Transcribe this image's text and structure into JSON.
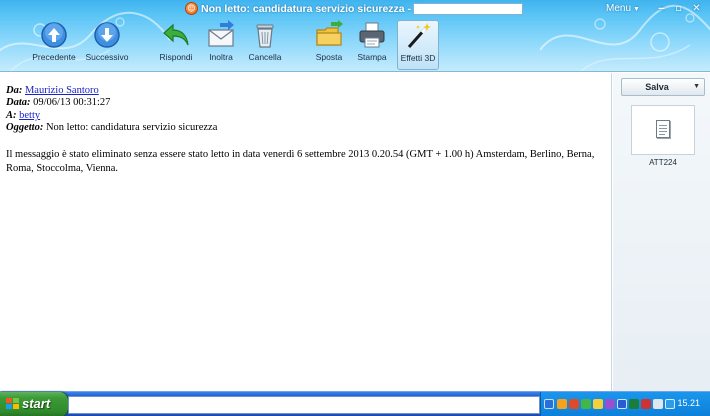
{
  "window": {
    "app_logo": "☺",
    "title": "Non letto: candidatura servizio sicurezza - Account",
    "menu_label": "Menu",
    "menu_arrow": "▼",
    "controls": {
      "minimize": "‒",
      "maximize": "▫",
      "close": "✕"
    }
  },
  "toolbar": {
    "buttons": [
      {
        "label": "Precedente",
        "icon": "arrow-up-circle-icon"
      },
      {
        "label": "Successivo",
        "icon": "arrow-down-circle-icon"
      },
      {
        "label": "Rispondi",
        "icon": "reply-arrow-icon"
      },
      {
        "label": "Inoltra",
        "icon": "forward-envelope-icon"
      },
      {
        "label": "Cancella",
        "icon": "trash-can-icon"
      },
      {
        "label": "Sposta",
        "icon": "folder-move-icon"
      },
      {
        "label": "Stampa",
        "icon": "printer-icon"
      },
      {
        "label": "Effetti 3D",
        "icon": "magic-wand-icon",
        "active": true
      }
    ]
  },
  "message": {
    "from_label": "Da:",
    "from_value": "Maurizio Santoro",
    "date_label": "Data:",
    "date_value": "09/06/13 00:31:27",
    "to_label": "A:",
    "to_value": "betty",
    "subject_label": "Oggetto:",
    "subject_value": "Non letto: candidatura servizio sicurezza",
    "body": "Il messaggio è stato eliminato senza essere stato letto in data venerdì 6 settembre 2013 0.20.54 (GMT + 1.00 h) Amsterdam, Berlino, Berna, Roma, Stoccolma, Vienna."
  },
  "attachments": {
    "save_label": "Salva",
    "save_arrow": "▼",
    "items": [
      {
        "name": "ATT224",
        "icon": "document-icon"
      }
    ]
  },
  "taskbar": {
    "start_label": "start",
    "clock": "15.21"
  },
  "colors": {
    "accent": "#3fb3ef",
    "link": "#1a23c9",
    "taskbar": "#2462d4",
    "start": "#3c9a37"
  }
}
